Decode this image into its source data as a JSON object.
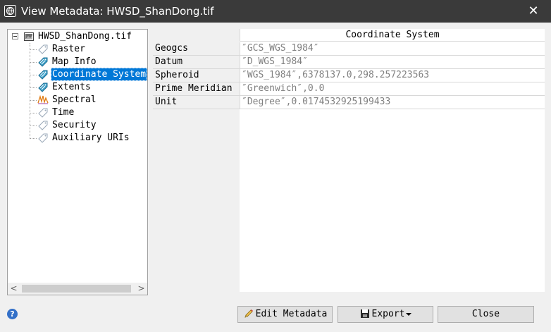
{
  "window": {
    "title": "View Metadata: HWSD_ShanDong.tif",
    "app_icon": "globe-icon",
    "close_glyph": "✕"
  },
  "tree": {
    "root_label": "HWSD_ShanDong.tif",
    "root_icon": "raster-file-icon",
    "items": [
      {
        "label": "Raster",
        "icon": "tag-gray-icon"
      },
      {
        "label": "Map Info",
        "icon": "tag-blue-icon"
      },
      {
        "label": "Coordinate System",
        "icon": "tag-blue-icon",
        "selected": true
      },
      {
        "label": "Extents",
        "icon": "tag-blue-icon"
      },
      {
        "label": "Spectral",
        "icon": "spectral-icon"
      },
      {
        "label": "Time",
        "icon": "tag-gray-icon"
      },
      {
        "label": "Security",
        "icon": "tag-gray-icon"
      },
      {
        "label": "Auxiliary URIs",
        "icon": "tag-gray-icon"
      }
    ],
    "scroll_left_glyph": "<",
    "scroll_right_glyph": ">"
  },
  "grid": {
    "header": "Coordinate System",
    "rows": [
      {
        "key": "Geogcs",
        "value": "″GCS_WGS_1984″"
      },
      {
        "key": "Datum",
        "value": "″D_WGS_1984″"
      },
      {
        "key": "Spheroid",
        "value": "″WGS_1984″,6378137.0,298.257223563"
      },
      {
        "key": "Prime Meridian",
        "value": "″Greenwich″,0.0"
      },
      {
        "key": "Unit",
        "value": "″Degree″,0.0174532925199433"
      }
    ]
  },
  "buttons": {
    "help_glyph": "?",
    "edit_label": "Edit Metadata",
    "export_label": "Export",
    "close_label": "Close"
  },
  "colors": {
    "titlebar": "#3a3a3a",
    "selection": "#0078d7",
    "value_text": "#808080"
  }
}
